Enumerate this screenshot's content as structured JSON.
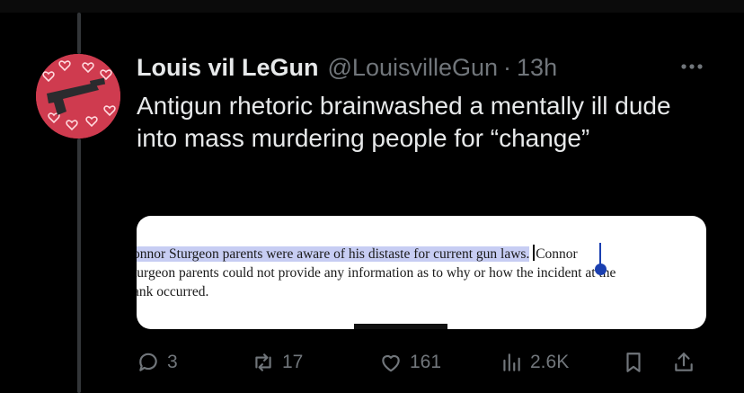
{
  "tweet": {
    "display_name": "Louis vil LeGun",
    "handle": "@LouisvilleGun",
    "separator": "·",
    "time": "13h",
    "text": "Antigun rhetoric brainwashed a mentally ill dude into mass murdering people for “change”",
    "more_icon": "more-horizontal-icon"
  },
  "media": {
    "line1_highlight": "onnor Sturgeon parents were aware of his distaste for current gun laws.",
    "line1_rest": "Connor",
    "line2": "turgeon parents could not provide any information as to why or how the incident at the",
    "line3": "ank occurred."
  },
  "actions": {
    "replies": "3",
    "reposts": "17",
    "likes": "161",
    "views": "2.6K",
    "icons": [
      "reply-icon",
      "repost-icon",
      "like-icon",
      "views-icon",
      "bookmark-icon",
      "share-icon"
    ]
  },
  "colors": {
    "background": "#000000",
    "text": "#e7e9ea",
    "secondary": "#71767b",
    "highlight": "#c7cdf3"
  }
}
